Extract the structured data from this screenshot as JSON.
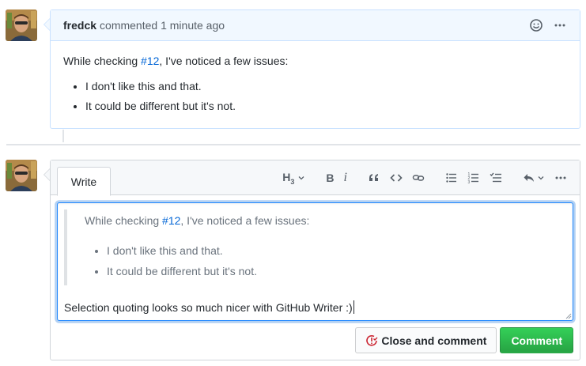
{
  "comment": {
    "author": "fredck",
    "action": "commented",
    "time": "1 minute ago",
    "body": {
      "intro_before": "While checking ",
      "issue_link": "#12",
      "intro_after": ", I've noticed a few issues:",
      "items": [
        "I don't like this and that.",
        "It could be different but it's not."
      ]
    },
    "icons": [
      "smiley-icon",
      "kebab-horizontal-icon"
    ]
  },
  "editor": {
    "tab_label": "Write",
    "toolbar_heading_label": "H",
    "toolbar_heading_sub": "3",
    "toolbar_bold": "B",
    "toolbar_italic": "i",
    "quote": {
      "intro_before": "While checking ",
      "issue_link": "#12",
      "intro_after": ", I've noticed a few issues:",
      "items": [
        "I don't like this and that.",
        "It could be different but it's not."
      ]
    },
    "typed_text": "Selection quoting looks so much nicer with GitHub Writer :)"
  },
  "buttons": {
    "close_label": "Close and comment",
    "comment_label": "Comment"
  },
  "colors": {
    "link": "#0366d6",
    "header_bg": "#f1f8ff",
    "header_border": "#c8e1ff",
    "comment_button": "#2cbe4e",
    "close_icon": "#cb2431"
  }
}
